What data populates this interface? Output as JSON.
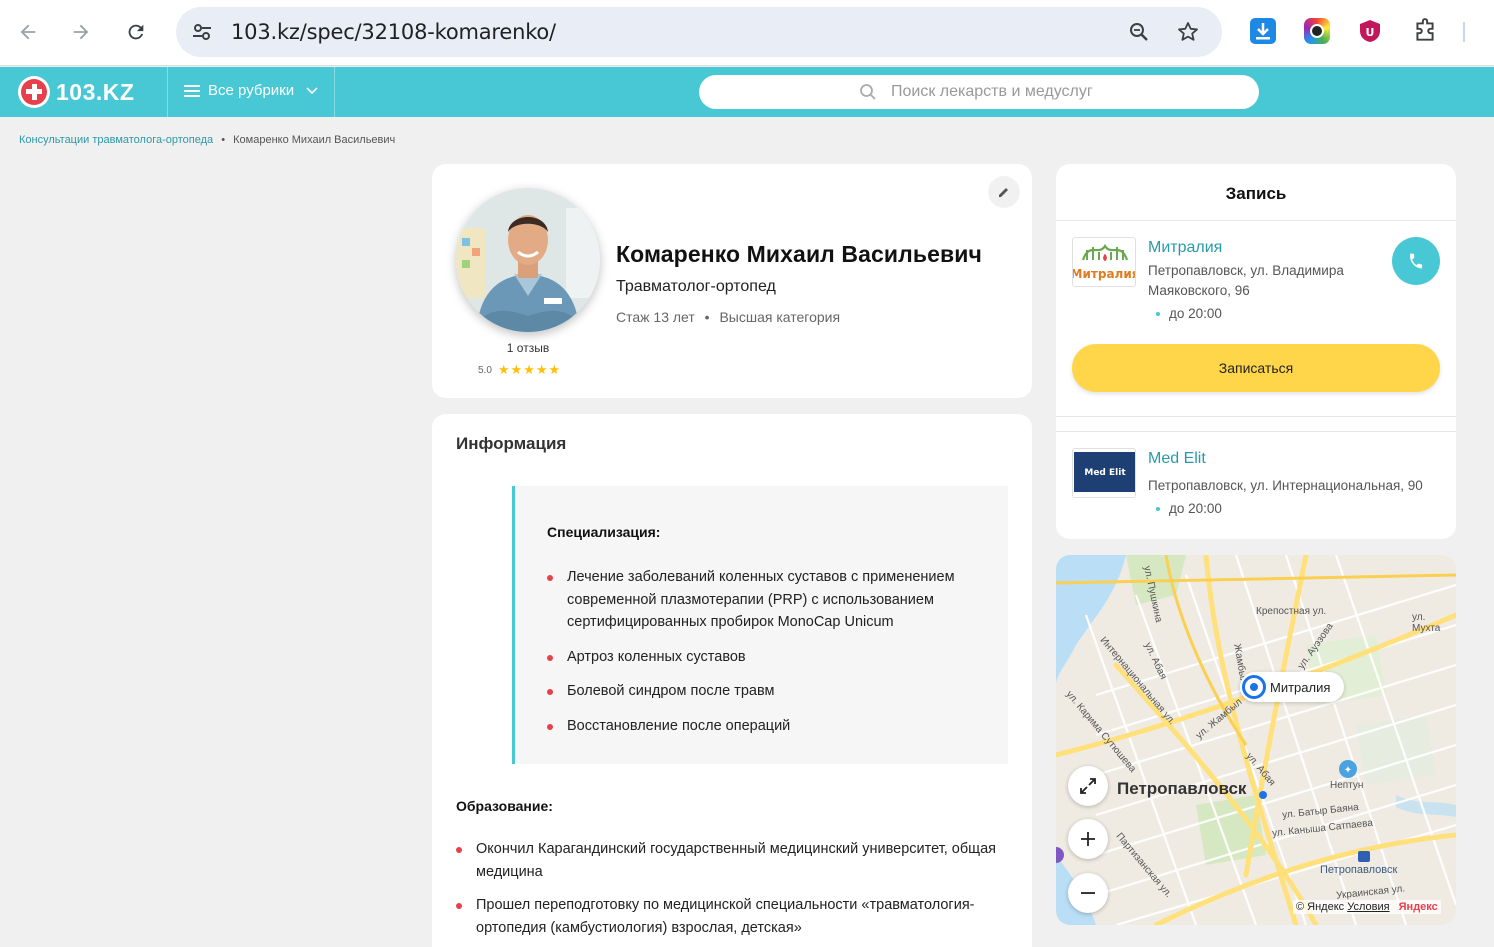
{
  "browser": {
    "url": "103.kz/spec/32108-komarenko/"
  },
  "site": {
    "logo_text": "103.KZ",
    "rubrics_label": "Все рубрики",
    "search_placeholder": "Поиск лекарств и медуслуг"
  },
  "breadcrumb": {
    "parent": "Консультации травматолога-ортопеда",
    "separator": "•",
    "current": "Комаренко Михаил Васильевич"
  },
  "profile": {
    "name": "Комаренко Михаил Васильевич",
    "specialty": "Травматолог-ортопед",
    "experience": "Стаж 13 лет",
    "bullet": "•",
    "category": "Высшая категория",
    "reviews": "1 отзыв",
    "rating": "5.0",
    "stars": "★★★★★"
  },
  "info": {
    "title": "Информация",
    "specialization_heading": "Специализация:",
    "specialization": [
      "Лечение заболеваний коленных суставов с применением современной плазмотерапии (PRP) с использованием сертифицированных пробирок MonoCap Unicum",
      "Артроз коленных суставов",
      "Болевой синдром после травм",
      "Восстановление после операций"
    ],
    "education_heading": "Образование:",
    "education": [
      "Окончил Карагандинский государственный медицинский университет, общая медицина",
      "Прошел переподготовку по медицинской специальности «травматология-ортопедия (камбустиология) взрослая, детская»"
    ]
  },
  "booking": {
    "title": "Запись",
    "clinics": [
      {
        "name": "Митралия",
        "logo_text": "Митралия",
        "address": "Петропавловск, ул. Владимира Маяковского, 96",
        "hours": "до 20:00"
      },
      {
        "name": "Med Elit",
        "logo_text": "Med Elit",
        "address": "Петропавловск, ул. Интернациональная, 90",
        "hours": "до 20:00"
      }
    ],
    "book_button": "Записаться"
  },
  "map": {
    "city": "Петропавловск",
    "pin_label": "Митралия",
    "streets": [
      "ул. Пушкина",
      "Крепостная ул.",
      "ул. Мухта",
      "Интернациональная ул.",
      "ул. Абая",
      "Жамбыла",
      "ул. Ауэзова",
      "ул. Карима Сутюшева",
      "ул. Жамбыл",
      "ул. Абая",
      "Нептун",
      "ул. Батыр Баяна",
      "ул. Каныша Сатпаева",
      "Партизанская ул.",
      "Петропавловск",
      "Украинская ул."
    ],
    "attribution": "© Яндекс",
    "terms": "Условия",
    "yandex": "Яндекс",
    "colors": {
      "water": "#b9def5",
      "road_major": "#ffe07a",
      "park": "#d5e8c2",
      "land": "#efebe3"
    }
  },
  "colors": {
    "accent": "#48c8d4",
    "brand_red": "#e8404b",
    "button_yellow": "#ffd54a",
    "star": "#ffc107",
    "link": "#2a9aa8"
  }
}
